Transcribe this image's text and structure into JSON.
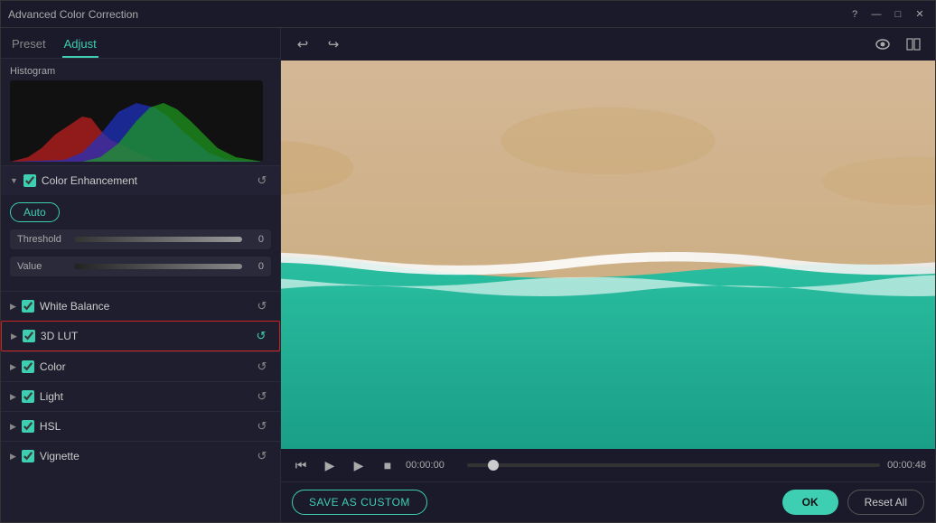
{
  "window": {
    "title": "Advanced Color Correction"
  },
  "titlebar": {
    "title": "Advanced Color Correction",
    "help_icon": "?",
    "minimize_icon": "—",
    "maximize_icon": "□",
    "close_icon": "✕"
  },
  "tabs": [
    {
      "id": "preset",
      "label": "Preset",
      "active": false
    },
    {
      "id": "adjust",
      "label": "Adjust",
      "active": true
    }
  ],
  "left_panel": {
    "histogram_label": "Histogram",
    "color_enhancement": {
      "label": "Color Enhancement",
      "auto_btn": "Auto",
      "sliders": [
        {
          "label": "Threshold",
          "value": "0"
        },
        {
          "label": "Value",
          "value": "0"
        }
      ]
    },
    "sections": [
      {
        "id": "white-balance",
        "label": "White Balance",
        "checked": true,
        "highlighted": false
      },
      {
        "id": "3d-lut",
        "label": "3D LUT",
        "checked": true,
        "highlighted": true
      },
      {
        "id": "color",
        "label": "Color",
        "checked": true,
        "highlighted": false
      },
      {
        "id": "light",
        "label": "Light",
        "checked": true,
        "highlighted": false
      },
      {
        "id": "hsl",
        "label": "HSL",
        "checked": true,
        "highlighted": false
      },
      {
        "id": "vignette",
        "label": "Vignette",
        "checked": true,
        "highlighted": false
      }
    ]
  },
  "playback": {
    "time_current": "00:00:00",
    "time_end": "00:00:48"
  },
  "bottom_bar": {
    "save_as_custom": "SAVE AS CUSTOM",
    "ok": "OK",
    "reset_all": "Reset All"
  },
  "icons": {
    "undo": "↩",
    "redo": "↪",
    "eye": "👁",
    "compare": "⊞",
    "prev_frame": "⏮",
    "play": "▶",
    "prev": "◀",
    "stop": "■",
    "reset_circle": "↺"
  }
}
